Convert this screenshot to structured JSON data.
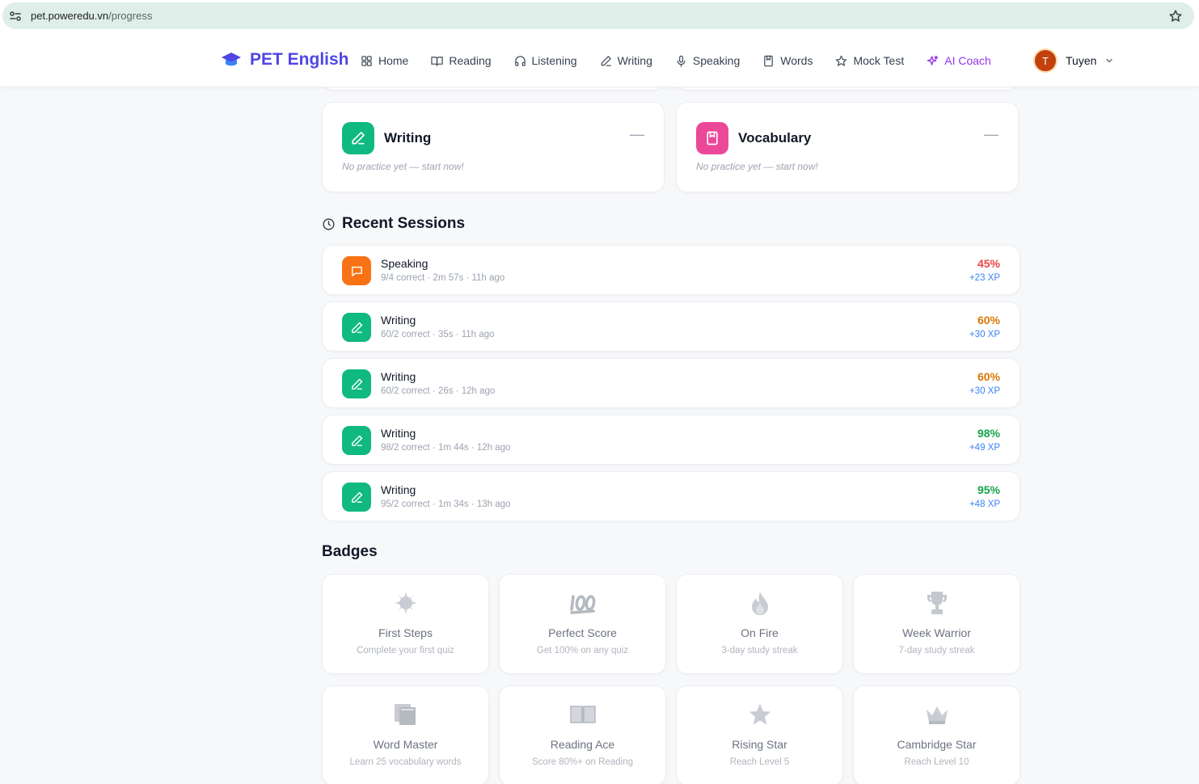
{
  "browser": {
    "url_host": "pet.poweredu.vn",
    "url_path": "/progress"
  },
  "nav": {
    "brand": "PET English",
    "items": [
      {
        "label": "Home",
        "icon": "grid-icon"
      },
      {
        "label": "Reading",
        "icon": "book-open-icon"
      },
      {
        "label": "Listening",
        "icon": "headphones-icon"
      },
      {
        "label": "Writing",
        "icon": "pencil-icon"
      },
      {
        "label": "Speaking",
        "icon": "microphone-icon"
      },
      {
        "label": "Words",
        "icon": "bookmark-book-icon"
      },
      {
        "label": "Mock Test",
        "icon": "star-icon"
      },
      {
        "label": "AI Coach",
        "icon": "sparkles-icon"
      }
    ],
    "user": {
      "initial": "T",
      "name": "Tuyen"
    }
  },
  "skills": [
    {
      "title": "Writing",
      "dash": "—",
      "note": "No practice yet — start now!",
      "color": "#10b981",
      "icon": "pencil-icon"
    },
    {
      "title": "Vocabulary",
      "dash": "—",
      "note": "No practice yet — start now!",
      "color": "#ec4899",
      "icon": "bookmark-book-icon"
    }
  ],
  "recent_sessions": {
    "title": "Recent Sessions",
    "items": [
      {
        "title": "Speaking",
        "meta": "9/4 correct · 2m 57s · 11h ago",
        "score": "45%",
        "xp": "+23 XP",
        "score_color": "#ef4444",
        "icon_color": "#f97316",
        "icon": "chat-bubble-icon"
      },
      {
        "title": "Writing",
        "meta": "60/2 correct · 35s · 11h ago",
        "score": "60%",
        "xp": "+30 XP",
        "score_color": "#d97706",
        "icon_color": "#10b981",
        "icon": "pencil-icon"
      },
      {
        "title": "Writing",
        "meta": "60/2 correct · 26s · 12h ago",
        "score": "60%",
        "xp": "+30 XP",
        "score_color": "#d97706",
        "icon_color": "#10b981",
        "icon": "pencil-icon"
      },
      {
        "title": "Writing",
        "meta": "98/2 correct · 1m 44s · 12h ago",
        "score": "98%",
        "xp": "+49 XP",
        "score_color": "#16a34a",
        "icon_color": "#10b981",
        "icon": "pencil-icon"
      },
      {
        "title": "Writing",
        "meta": "95/2 correct · 1m 34s · 13h ago",
        "score": "95%",
        "xp": "+48 XP",
        "score_color": "#16a34a",
        "icon_color": "#10b981",
        "icon": "pencil-icon"
      }
    ]
  },
  "badges": {
    "title": "Badges",
    "items": [
      {
        "title": "First Steps",
        "desc": "Complete your first quiz",
        "icon": "sparkle-burst-icon"
      },
      {
        "title": "Perfect Score",
        "desc": "Get 100% on any quiz",
        "icon": "hundred-points-icon"
      },
      {
        "title": "On Fire",
        "desc": "3-day study streak",
        "icon": "flame-icon"
      },
      {
        "title": "Week Warrior",
        "desc": "7-day study streak",
        "icon": "trophy-icon"
      },
      {
        "title": "Word Master",
        "desc": "Learn 25 vocabulary words",
        "icon": "books-icon"
      },
      {
        "title": "Reading Ace",
        "desc": "Score 80%+ on Reading",
        "icon": "open-book-icon"
      },
      {
        "title": "Rising Star",
        "desc": "Reach Level 5",
        "icon": "star-icon"
      },
      {
        "title": "Cambridge Star",
        "desc": "Reach Level 10",
        "icon": "crown-icon"
      }
    ]
  }
}
